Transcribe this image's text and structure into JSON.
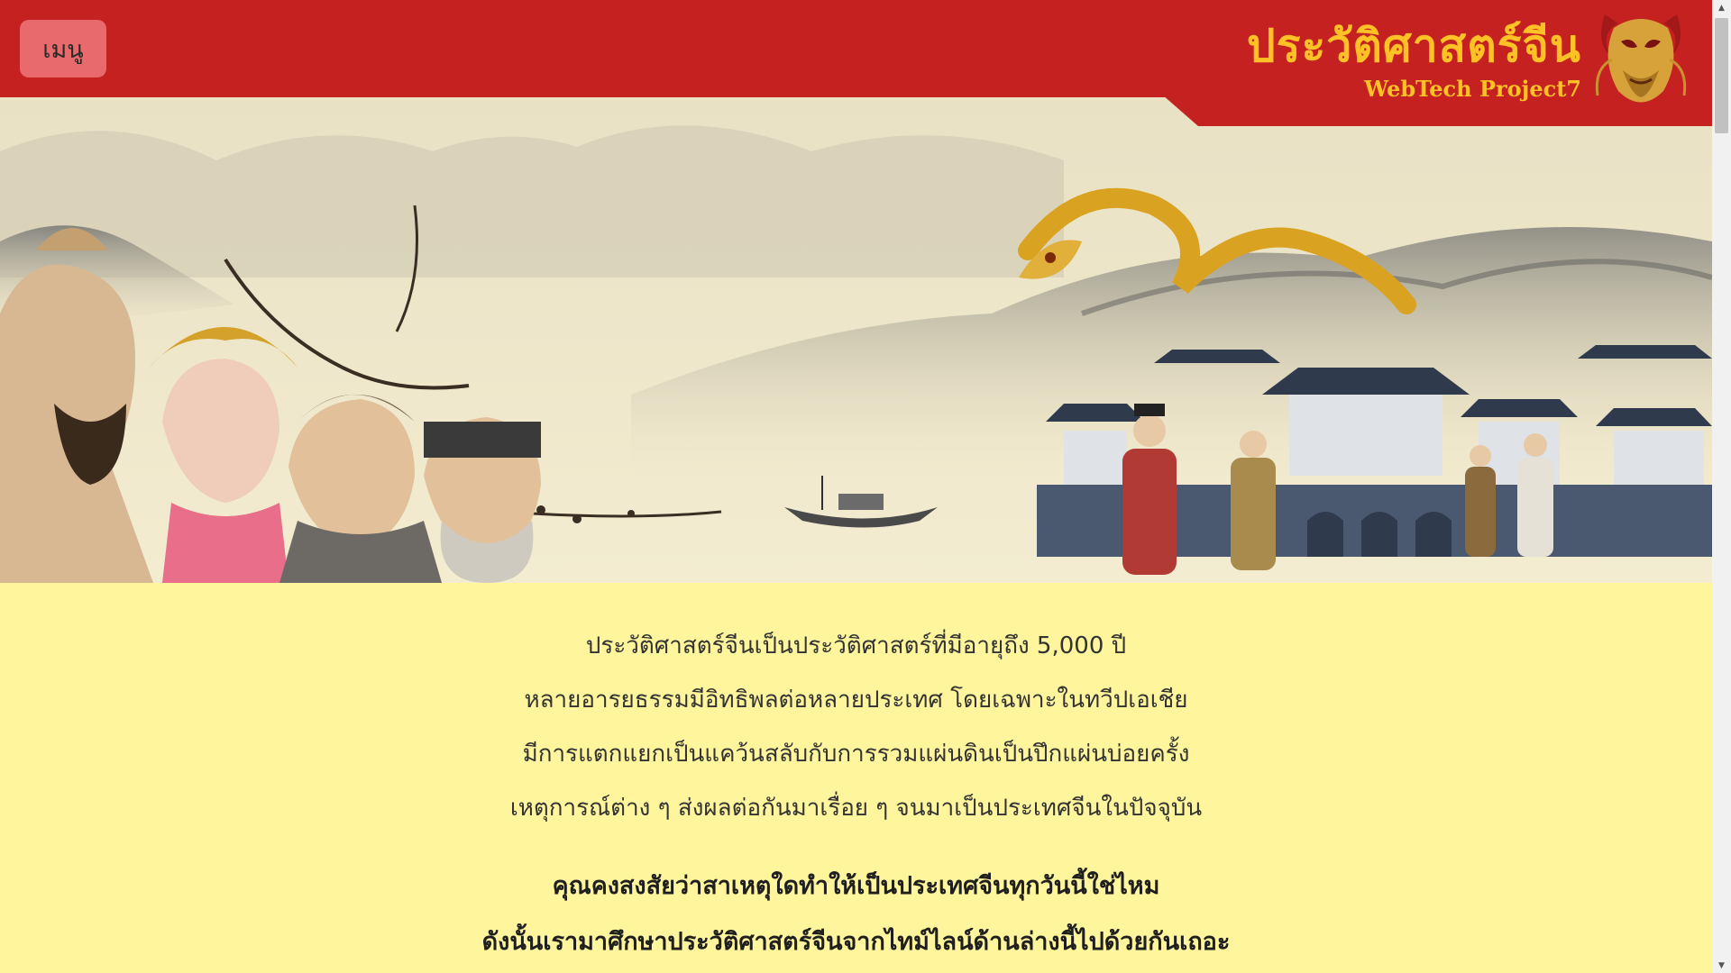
{
  "header": {
    "menu_label": "เมนู",
    "title": "ประวัติศาสตร์จีน",
    "subtitle": "WebTech Project7",
    "logo_icon": "dragon-icon"
  },
  "banner": {
    "image": "chinese-ink-painting-banner"
  },
  "intro": {
    "lines": [
      "ประวัติศาสตร์จีนเป็นประวัติศาสตร์ที่มีอายุถึง 5,000 ปี",
      "หลายอารยธรรมมีอิทธิพลต่อหลายประเทศ โดยเฉพาะในทวีปเอเชีย",
      "มีการแตกแยกเป็นแคว้นสลับกับการรวมแผ่นดินเป็นปึกแผ่นบ่อยครั้ง",
      "เหตุการณ์ต่าง ๆ ส่งผลต่อกันมาเรื่อย ๆ จนมาเป็นประเทศจีนในปัจจุบัน"
    ]
  },
  "question": {
    "lines": [
      "คุณคงสงสัยว่าสาเหตุใดทำให้เป็นประเทศจีนทุกวันนี้ใช่ไหม",
      "ดังนั้นเรามาศึกษาประวัติศาสตร์จีนจากไทม์ไลน์ด้านล่างนี้ไปด้วยกันเถอะ"
    ]
  },
  "colors": {
    "header_bg": "#c62121",
    "menu_bg": "#e96a6c",
    "title_gold": "#ffc226",
    "content_bg": "#fff59d"
  }
}
